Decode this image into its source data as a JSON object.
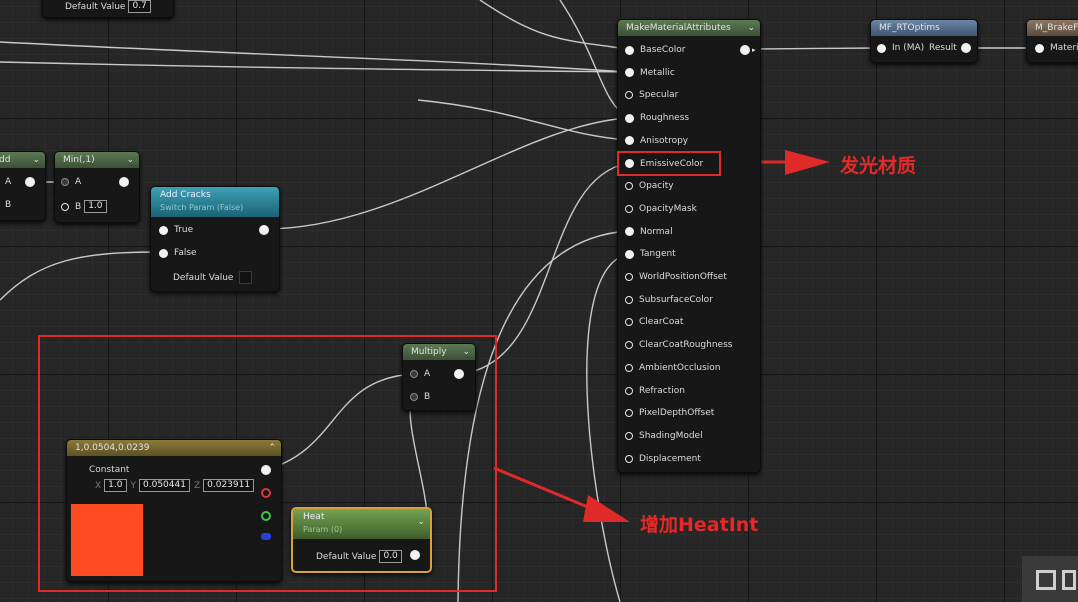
{
  "nodes": {
    "partial_top": {
      "default_label": "Default Value",
      "default_value": "0.7"
    },
    "make_material_attributes": {
      "title": "MakeMaterialAttributes",
      "pins": [
        "BaseColor",
        "Metallic",
        "Specular",
        "Roughness",
        "Anisotropy",
        "EmissiveColor",
        "Opacity",
        "OpacityMask",
        "Normal",
        "Tangent",
        "WorldPositionOffset",
        "SubsurfaceColor",
        "ClearCoat",
        "ClearCoatRoughness",
        "AmbientOcclusion",
        "Refraction",
        "PixelDepthOffset",
        "ShadingModel",
        "Displacement"
      ]
    },
    "mf_rtoptims": {
      "title": "MF_RTOptims",
      "in_label": "In (MA)",
      "out_label": "Result"
    },
    "m_brake": {
      "title": "M_BrakeF",
      "in_label": "Materi"
    },
    "add_partial": {
      "title": "dd",
      "pin_a": "A",
      "pin_b": "B"
    },
    "min": {
      "title": "Min(,1)",
      "pin_a": "A",
      "pin_b": "B",
      "b_value": "1.0"
    },
    "add_cracks": {
      "title": "Add Cracks",
      "subtitle": "Switch Param (False)",
      "pin_true": "True",
      "pin_false": "False",
      "default_label": "Default Value"
    },
    "multiply": {
      "title": "Multiply",
      "pin_a": "A",
      "pin_b": "B"
    },
    "constant": {
      "title": "1,0.0504,0.0239",
      "label": "Constant",
      "x_label": "X",
      "x_value": "1.0",
      "y_label": "Y",
      "y_value": "0.050441",
      "z_label": "Z",
      "z_value": "0.023911",
      "swatch_color": "#ff4a22"
    },
    "heat": {
      "title": "Heat",
      "subtitle": "Param (0)",
      "default_label": "Default Value",
      "default_value": "0.0"
    }
  },
  "annotations": {
    "emissive": "发光材质",
    "heatint": "增加HeatInt"
  },
  "colors": {
    "annotation_red": "#e02a2a"
  }
}
